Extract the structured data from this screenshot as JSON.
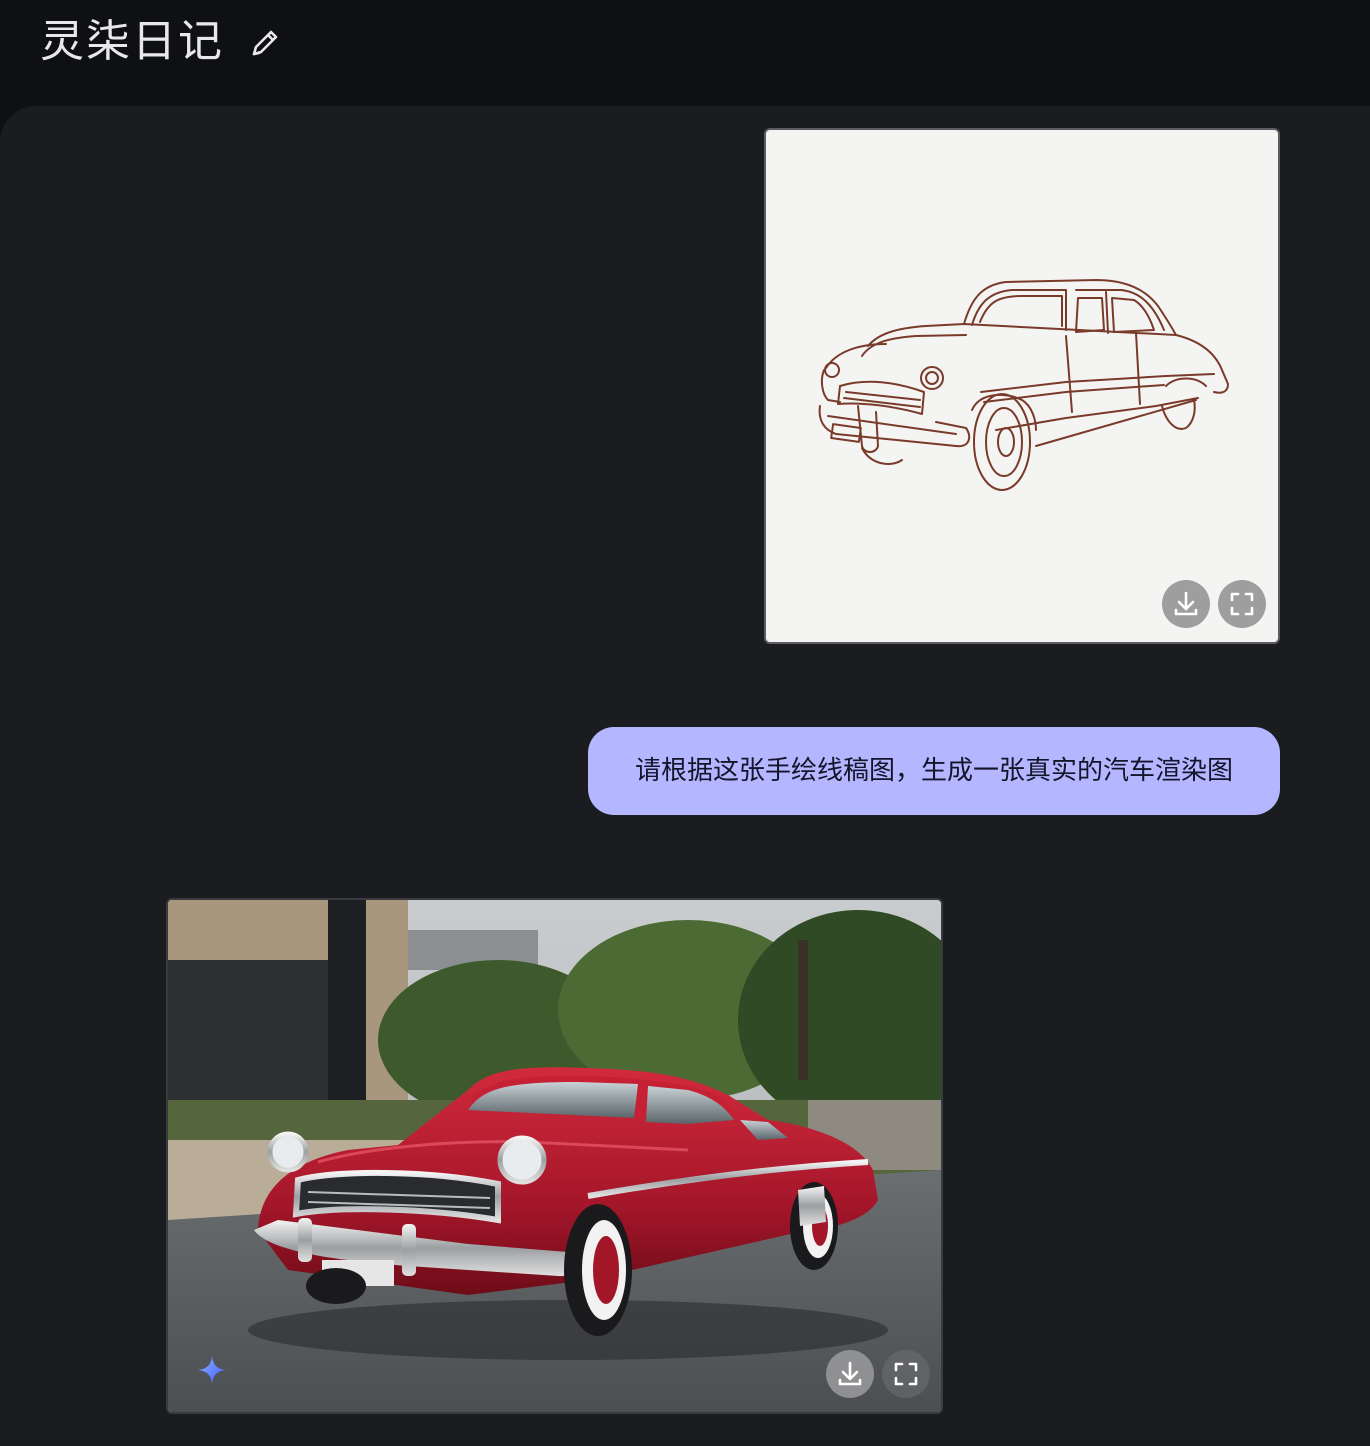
{
  "header": {
    "title": "灵柒日记",
    "edit_icon": "pencil-icon"
  },
  "messages": [
    {
      "role": "user",
      "type": "image",
      "image": "hand-drawn line sketch of a vintage car",
      "actions": [
        "download-icon",
        "fullscreen-icon"
      ]
    },
    {
      "role": "user",
      "type": "text",
      "text": "请根据这张手绘线稿图，生成一张真实的汽车渲染图"
    },
    {
      "role": "assistant",
      "type": "image",
      "image": "photorealistic red vintage sedan parked outdoors",
      "badge_icon": "sparkle-icon",
      "actions": [
        "download-icon",
        "fullscreen-icon"
      ]
    }
  ],
  "colors": {
    "background": "#0f1013",
    "chat_surface": "#1b1c1f",
    "user_bubble": "#b4b6ff",
    "sketch_line": "#7a3a2a",
    "car_red": "#b3182b"
  }
}
